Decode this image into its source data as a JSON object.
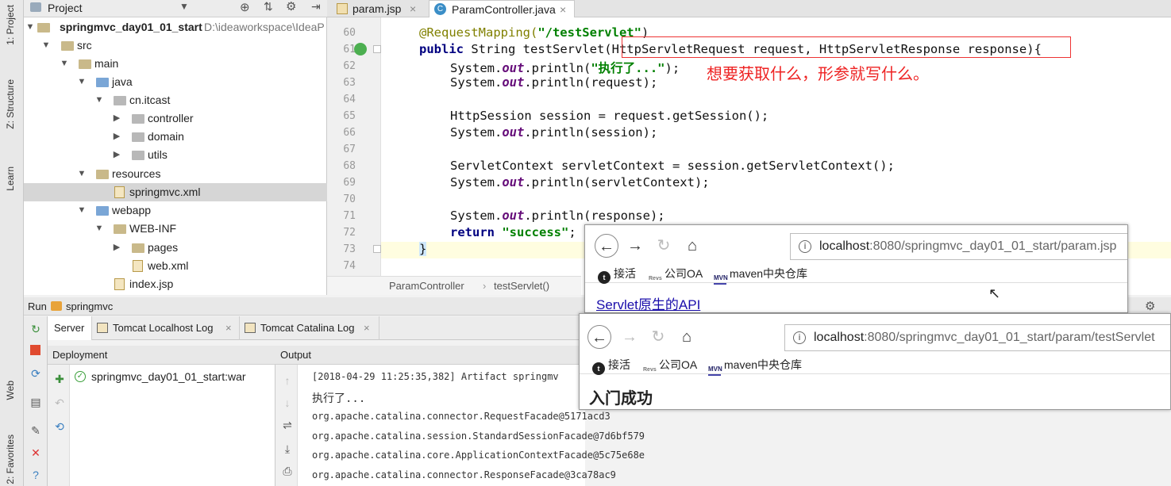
{
  "left_strip": {
    "project_tab": "1: Project",
    "structure_tab": "Z: Structure",
    "learn_tab": "Learn",
    "web_tab": "Web",
    "favorites_tab": "2: Favorites"
  },
  "project_panel": {
    "header": "Project",
    "tree": [
      {
        "label": "springmvc_day01_01_start",
        "path": "D:\\ideaworkspace\\IdeaP"
      },
      {
        "label": "src"
      },
      {
        "label": "main"
      },
      {
        "label": "java"
      },
      {
        "label": "cn.itcast"
      },
      {
        "label": "controller"
      },
      {
        "label": "domain"
      },
      {
        "label": "utils"
      },
      {
        "label": "resources"
      },
      {
        "label": "springmvc.xml"
      },
      {
        "label": "webapp"
      },
      {
        "label": "WEB-INF"
      },
      {
        "label": "pages"
      },
      {
        "label": "web.xml"
      },
      {
        "label": "index.jsp"
      }
    ]
  },
  "editor": {
    "tabs": [
      {
        "label": "param.jsp"
      },
      {
        "label": "ParamController.java"
      }
    ],
    "line_numbers": [
      "60",
      "61",
      "62",
      "63",
      "64",
      "65",
      "66",
      "67",
      "68",
      "69",
      "70",
      "71",
      "72",
      "73",
      "74"
    ],
    "lines": {
      "l60_ann": "@RequestMapping(",
      "l60_str": "\"/testServlet\"",
      "l60_end": ")",
      "l61_kw": "public",
      "l61_mid": " String testServlet(",
      "l61_params": "HttpServletRequest request, HttpServletResponse response",
      "l61_end": "){",
      "l62_a": "System.",
      "l62_out": "out",
      "l62_b": ".println(",
      "l62_str": "\"执行了...\"",
      "l62_c": ");",
      "l63_a": "System.",
      "l63_out": "out",
      "l63_b": ".println(request);",
      "l65": "HttpSession session = request.getSession();",
      "l66_a": "System.",
      "l66_out": "out",
      "l66_b": ".println(session);",
      "l68": "ServletContext servletContext = session.getServletContext();",
      "l69_a": "System.",
      "l69_out": "out",
      "l69_b": ".println(servletContext);",
      "l71_a": "System.",
      "l71_out": "out",
      "l71_b": ".println(response);",
      "l72_kw": "return",
      "l72_str": " \"success\"",
      "l72_end": ";",
      "l73": "}"
    },
    "annotation_note": "想要获取什么，形参就写什么。",
    "breadcrumb": {
      "class_name": "ParamController",
      "method_name": "testServlet()"
    }
  },
  "run_panel": {
    "title": "Run",
    "config": "springmvc",
    "tabs": [
      {
        "label": "Server"
      },
      {
        "label": "Tomcat Localhost Log"
      },
      {
        "label": "Tomcat Catalina Log"
      }
    ],
    "deployment_header": "Deployment",
    "deployment_item": "springmvc_day01_01_start:war",
    "output_header": "Output",
    "output_lines": [
      "[2018-04-29 11:25:35,382] Artifact springmv",
      "执行了...",
      "org.apache.catalina.connector.RequestFacade@5171acd3",
      "org.apache.catalina.session.StandardSessionFacade@7d6bf579",
      "org.apache.catalina.core.ApplicationContextFacade@5c75e68e",
      "org.apache.catalina.connector.ResponseFacade@3ca78ac9"
    ]
  },
  "browser1": {
    "url_host": "localhost",
    "url_path": ":8080/springmvc_day01_01_start/param.jsp",
    "bookmarks": [
      {
        "label": "接活"
      },
      {
        "label": "公司OA"
      },
      {
        "label": "maven中央仓库"
      }
    ],
    "link_text": "Servlet原生的API"
  },
  "browser2": {
    "url_host": "localhost",
    "url_path": ":8080/springmvc_day01_01_start/param/testServlet",
    "bookmarks": [
      {
        "label": "接活"
      },
      {
        "label": "公司OA"
      },
      {
        "label": "maven中央仓库"
      }
    ],
    "page_text": "入门成功"
  },
  "colors": {
    "annotation_red": "#e22222",
    "string_green": "#008000",
    "keyword_navy": "#000080",
    "link_blue": "#1a0dab"
  }
}
